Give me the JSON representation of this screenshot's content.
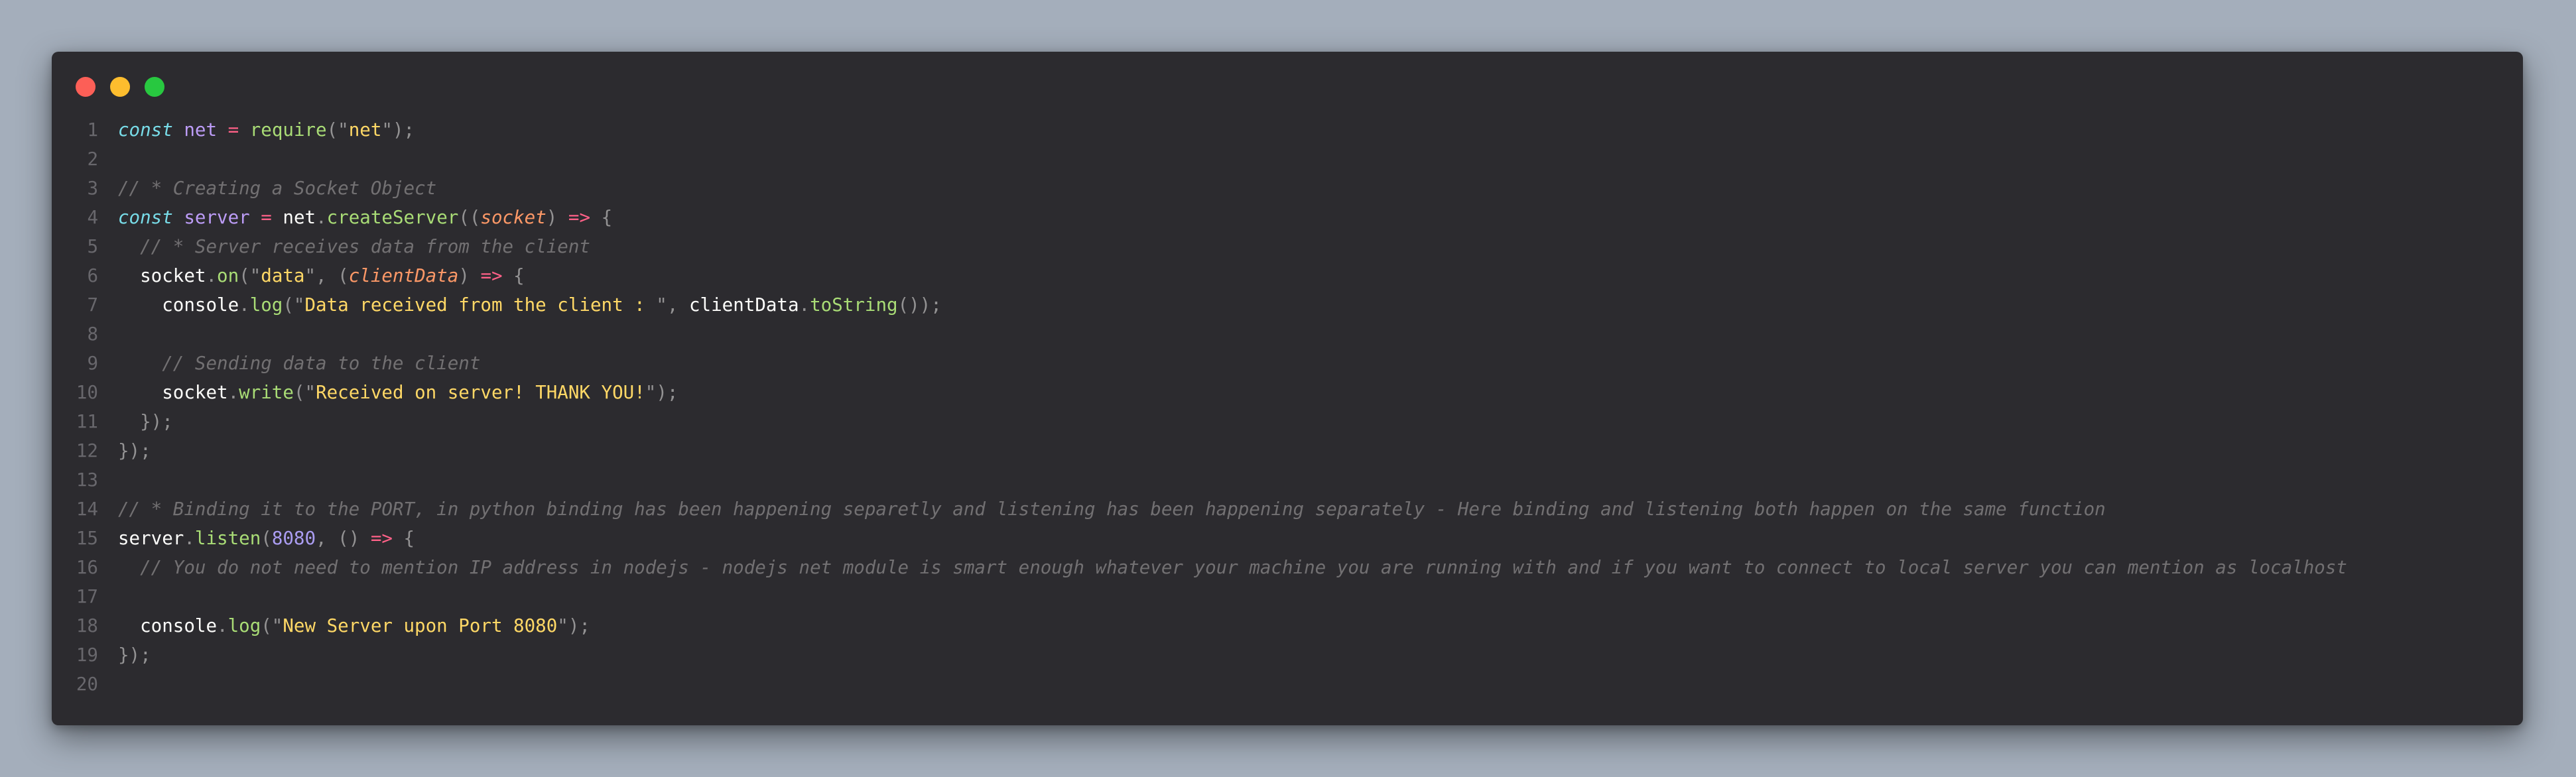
{
  "window": {
    "controls": [
      "close",
      "minimize",
      "maximize"
    ]
  },
  "code": {
    "lines": [
      {
        "n": "1",
        "tokens": [
          [
            "kw",
            "const"
          ],
          [
            "tx",
            " "
          ],
          [
            "vr",
            "net"
          ],
          [
            "tx",
            " "
          ],
          [
            "op",
            "="
          ],
          [
            "tx",
            " "
          ],
          [
            "fn",
            "require"
          ],
          [
            "pn",
            "(\""
          ],
          [
            "st",
            "net"
          ],
          [
            "pn",
            "\");"
          ]
        ]
      },
      {
        "n": "2",
        "tokens": []
      },
      {
        "n": "3",
        "tokens": [
          [
            "cm",
            "// * Creating a Socket Object"
          ]
        ]
      },
      {
        "n": "4",
        "tokens": [
          [
            "kw",
            "const"
          ],
          [
            "tx",
            " "
          ],
          [
            "vr",
            "server"
          ],
          [
            "tx",
            " "
          ],
          [
            "op",
            "="
          ],
          [
            "tx",
            " net"
          ],
          [
            "pn",
            "."
          ],
          [
            "fn",
            "createServer"
          ],
          [
            "pn",
            "(("
          ],
          [
            "pm",
            "socket"
          ],
          [
            "pn",
            ")"
          ],
          [
            "tx",
            " "
          ],
          [
            "op",
            "=>"
          ],
          [
            "tx",
            " "
          ],
          [
            "pn",
            "{"
          ]
        ]
      },
      {
        "n": "5",
        "tokens": [
          [
            "tx",
            "  "
          ],
          [
            "cm",
            "// * Server receives data from the client"
          ]
        ]
      },
      {
        "n": "6",
        "tokens": [
          [
            "tx",
            "  socket"
          ],
          [
            "pn",
            "."
          ],
          [
            "fn",
            "on"
          ],
          [
            "pn",
            "(\""
          ],
          [
            "st",
            "data"
          ],
          [
            "pn",
            "\", ("
          ],
          [
            "pm",
            "clientData"
          ],
          [
            "pn",
            ")"
          ],
          [
            "tx",
            " "
          ],
          [
            "op",
            "=>"
          ],
          [
            "tx",
            " "
          ],
          [
            "pn",
            "{"
          ]
        ]
      },
      {
        "n": "7",
        "tokens": [
          [
            "tx",
            "    console"
          ],
          [
            "pn",
            "."
          ],
          [
            "fn",
            "log"
          ],
          [
            "pn",
            "(\""
          ],
          [
            "st",
            "Data received from the client : "
          ],
          [
            "pn",
            "\","
          ],
          [
            "tx",
            " clientData"
          ],
          [
            "pn",
            "."
          ],
          [
            "fn",
            "toString"
          ],
          [
            "pn",
            "());"
          ]
        ]
      },
      {
        "n": "8",
        "tokens": []
      },
      {
        "n": "9",
        "tokens": [
          [
            "tx",
            "    "
          ],
          [
            "cm",
            "// Sending data to the client"
          ]
        ]
      },
      {
        "n": "10",
        "tokens": [
          [
            "tx",
            "    socket"
          ],
          [
            "pn",
            "."
          ],
          [
            "fn",
            "write"
          ],
          [
            "pn",
            "(\""
          ],
          [
            "st",
            "Received on server! THANK YOU!"
          ],
          [
            "pn",
            "\");"
          ]
        ]
      },
      {
        "n": "11",
        "tokens": [
          [
            "pn",
            "  });"
          ]
        ]
      },
      {
        "n": "12",
        "tokens": [
          [
            "pn",
            "});"
          ]
        ]
      },
      {
        "n": "13",
        "tokens": []
      },
      {
        "n": "14",
        "tokens": [
          [
            "cm",
            "// * Binding it to the PORT, in python binding has been happening separetly and listening has been happening separately - Here binding and listening both happen on the same function"
          ]
        ]
      },
      {
        "n": "15",
        "tokens": [
          [
            "tx",
            "server"
          ],
          [
            "pn",
            "."
          ],
          [
            "fn",
            "listen"
          ],
          [
            "pn",
            "("
          ],
          [
            "nm",
            "8080"
          ],
          [
            "pn",
            ", ()"
          ],
          [
            "tx",
            " "
          ],
          [
            "op",
            "=>"
          ],
          [
            "tx",
            " "
          ],
          [
            "pn",
            "{"
          ]
        ]
      },
      {
        "n": "16",
        "tokens": [
          [
            "tx",
            "  "
          ],
          [
            "cm",
            "// You do not need to mention IP address in nodejs - nodejs net module is smart enough whatever your machine you are running with and if you want to connect to local server you can mention as localhost"
          ]
        ]
      },
      {
        "n": "17",
        "tokens": []
      },
      {
        "n": "18",
        "tokens": [
          [
            "tx",
            "  console"
          ],
          [
            "pn",
            "."
          ],
          [
            "fn",
            "log"
          ],
          [
            "pn",
            "(\""
          ],
          [
            "st",
            "New Server upon Port 8080"
          ],
          [
            "pn",
            "\");"
          ]
        ]
      },
      {
        "n": "19",
        "tokens": [
          [
            "pn",
            "});"
          ]
        ]
      },
      {
        "n": "20",
        "tokens": []
      }
    ]
  }
}
